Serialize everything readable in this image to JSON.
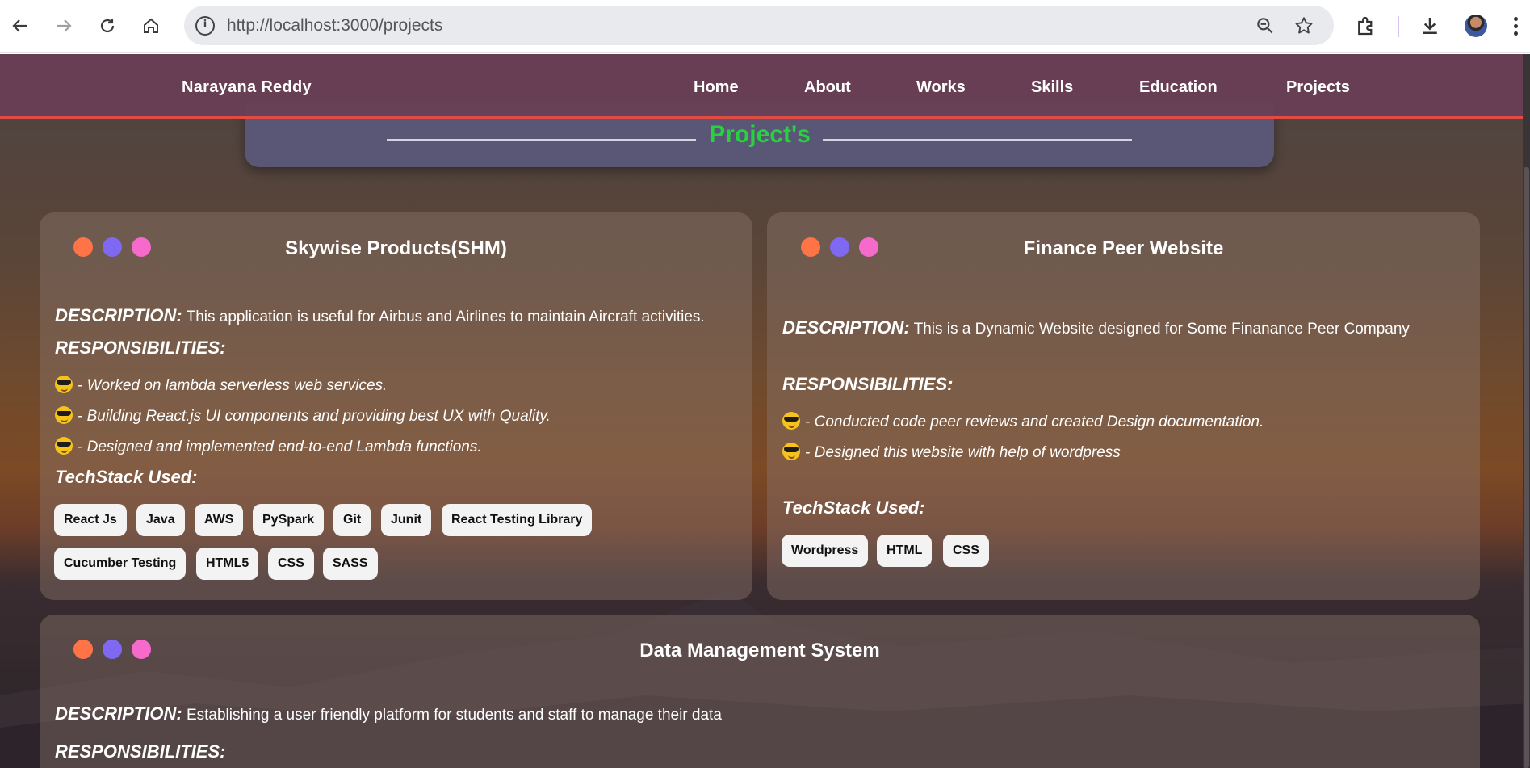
{
  "browser": {
    "url": "http://localhost:3000/projects"
  },
  "site": {
    "brand": "Narayana Reddy",
    "nav": [
      "Home",
      "About",
      "Works",
      "Skills",
      "Education",
      "Projects"
    ],
    "section_title": "Project's"
  },
  "projects": [
    {
      "title": "Skywise Products(SHM)",
      "description_label": "DESCRIPTION:",
      "description": "This application is useful for Airbus and Airlines to maintain Aircraft activities.",
      "responsibilities_label": "RESPONSIBILITIES:",
      "responsibilities": [
        "- Worked on lambda serverless web services.",
        "- Building React.js UI components and providing best UX with Quality.",
        "- Designed and implemented end-to-end Lambda functions."
      ],
      "tech_label": "TechStack Used:",
      "tech": [
        "React Js",
        "Java",
        "AWS",
        "PySpark",
        "Git",
        "Junit",
        "React Testing Library",
        "Cucumber Testing",
        "HTML5",
        "CSS",
        "SASS"
      ]
    },
    {
      "title": "Finance Peer Website",
      "description_label": "DESCRIPTION:",
      "description": "This is a Dynamic Website designed for Some Finanance Peer Company",
      "responsibilities_label": "RESPONSIBILITIES:",
      "responsibilities": [
        "- Conducted code peer reviews and created Design documentation.",
        "- Designed this website with help of wordpress"
      ],
      "tech_label": "TechStack Used:",
      "tech": [
        "Wordpress",
        "HTML",
        "CSS"
      ]
    },
    {
      "title": "Data Management System",
      "description_label": "DESCRIPTION:",
      "description": "Establishing a user friendly platform for students and staff to manage their data",
      "responsibilities_label": "RESPONSIBILITIES:"
    }
  ],
  "colors": {
    "dot_1": "#ff7447",
    "dot_2": "#7f68f2",
    "dot_3": "#f56acb",
    "section_title": "#27d23f",
    "header_border": "#e04b44"
  }
}
